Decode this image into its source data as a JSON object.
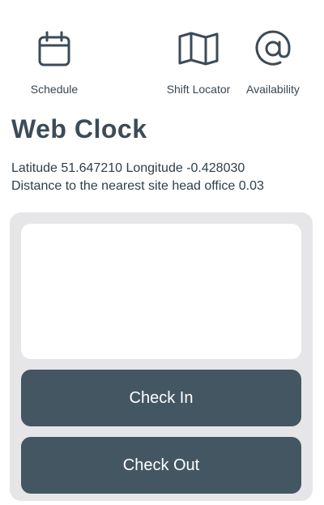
{
  "nav": {
    "items": [
      {
        "label": "Schedule",
        "icon": "calendar-icon"
      },
      {
        "label": "Shift Locator",
        "icon": "map-icon"
      },
      {
        "label": "Availability",
        "icon": "at-sign-icon"
      }
    ]
  },
  "page": {
    "title": "Web Clock"
  },
  "location": {
    "coordinates_text": "Latitude 51.647210 Longitude -0.428030",
    "distance_text": "Distance to the nearest site head office 0.03"
  },
  "actions": {
    "check_in_label": "Check In",
    "check_out_label": "Check Out"
  },
  "colors": {
    "primary": "#455663",
    "card_background": "#e6e6e9",
    "text": "#2f3e49"
  }
}
